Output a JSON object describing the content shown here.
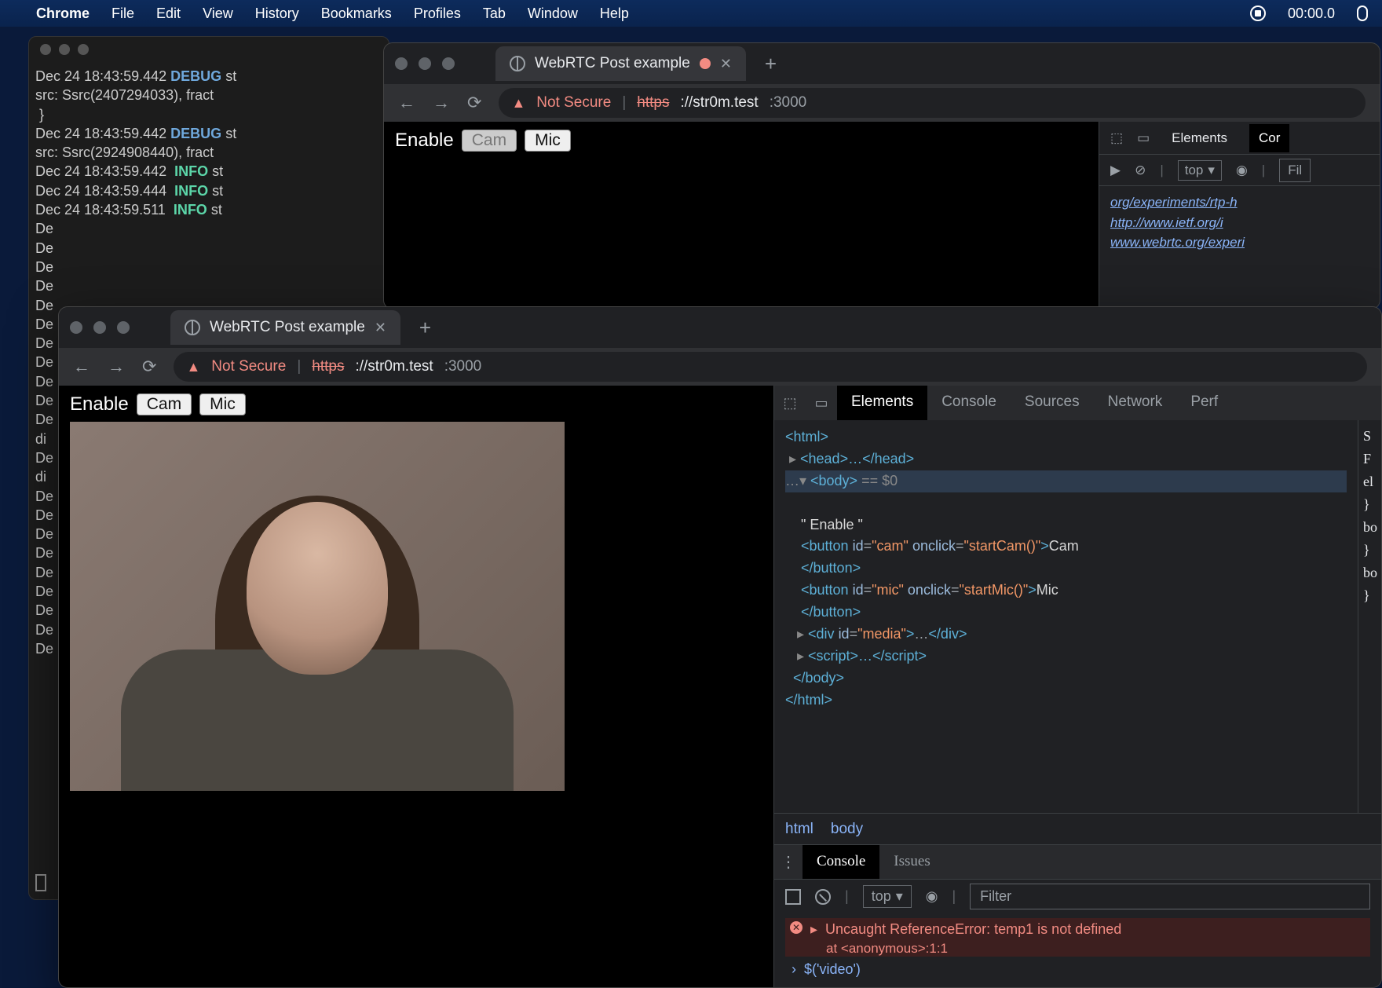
{
  "menubar": {
    "app": "Chrome",
    "items": [
      "File",
      "Edit",
      "View",
      "History",
      "Bookmarks",
      "Profiles",
      "Tab",
      "Window",
      "Help"
    ],
    "timer": "00:00.0"
  },
  "terminal": {
    "lines": [
      {
        "ts": "Dec 24 18:43:59.442",
        "lvl": "DEBUG",
        "rest": "st"
      },
      {
        "raw": "src: Ssrc(2407294033), fract"
      },
      {
        "raw": " }"
      },
      {
        "ts": "Dec 24 18:43:59.442",
        "lvl": "DEBUG",
        "rest": "st"
      },
      {
        "raw": "src: Ssrc(2924908440), fract"
      },
      {
        "ts": "Dec 24 18:43:59.442",
        "lvl": "INFO",
        "rest": "st"
      },
      {
        "ts": "Dec 24 18:43:59.444",
        "lvl": "INFO",
        "rest": "st"
      },
      {
        "ts": "Dec 24 18:43:59.511",
        "lvl": "INFO",
        "rest": "st"
      },
      {
        "raw": "De"
      },
      {
        "raw": "De"
      },
      {
        "raw": "De"
      },
      {
        "raw": "De"
      },
      {
        "raw": "De"
      },
      {
        "raw": "De"
      },
      {
        "raw": "De"
      },
      {
        "raw": "De"
      },
      {
        "raw": "De"
      },
      {
        "raw": "De"
      },
      {
        "raw": "De"
      },
      {
        "raw": "di"
      },
      {
        "raw": "De"
      },
      {
        "raw": "di"
      },
      {
        "raw": "De"
      },
      {
        "raw": "De"
      },
      {
        "raw": "De"
      },
      {
        "raw": "De"
      },
      {
        "raw": "De"
      },
      {
        "raw": "De"
      },
      {
        "raw": "De"
      },
      {
        "raw": "De"
      },
      {
        "raw": "De"
      }
    ]
  },
  "chrome_back": {
    "tab": {
      "title": "WebRTC Post example"
    },
    "url": {
      "warn": "Not Secure",
      "scheme": "https",
      "host": "://str0m.test",
      "port": ":3000"
    },
    "page": {
      "enable": "Enable",
      "cam": "Cam",
      "mic": "Mic"
    },
    "devtools": {
      "tabs": [
        "Elements",
        "Cor"
      ],
      "top": "top",
      "filter": "Fil",
      "links": [
        "org/experiments/rtp-h",
        "http://www.ietf.org/i",
        "www.webrtc.org/experi"
      ]
    }
  },
  "chrome_front": {
    "tab": {
      "title": "WebRTC Post example"
    },
    "url": {
      "warn": "Not Secure",
      "scheme": "https",
      "host": "://str0m.test",
      "port": ":3000"
    },
    "page": {
      "enable": "Enable",
      "cam": "Cam",
      "mic": "Mic"
    },
    "devtools": {
      "tabs": [
        "Elements",
        "Console",
        "Sources",
        "Network",
        "Perf"
      ],
      "breadcrumb": [
        "html",
        "body"
      ],
      "styles_letters": [
        "S",
        "F",
        "el",
        "}",
        "bo",
        "}",
        "bo",
        "}"
      ],
      "dom": {
        "html_open": "<html>",
        "head": "<head>…</head>",
        "body_open": "<body>",
        "body_sel": " == $0",
        "text_enable": "\" Enable \"",
        "btn_cam_open": "<button id=\"cam\" onclick=\"startCam()\">",
        "btn_cam_txt": "Cam",
        "btn_close": "</button>",
        "btn_mic_open": "<button id=\"mic\" onclick=\"startMic()\">",
        "btn_mic_txt": "Mic",
        "div_media": "<div id=\"media\">…</div>",
        "script": "<script>…</script>",
        "body_close": "</body>",
        "html_close": "</html>"
      },
      "console": {
        "tabs": [
          "Console",
          "Issues"
        ],
        "top": "top",
        "filter_ph": "Filter",
        "error": "Uncaught ReferenceError: temp1 is not defined",
        "error_at": "at <anonymous>:1:1",
        "prompt": "$('video')"
      }
    }
  }
}
